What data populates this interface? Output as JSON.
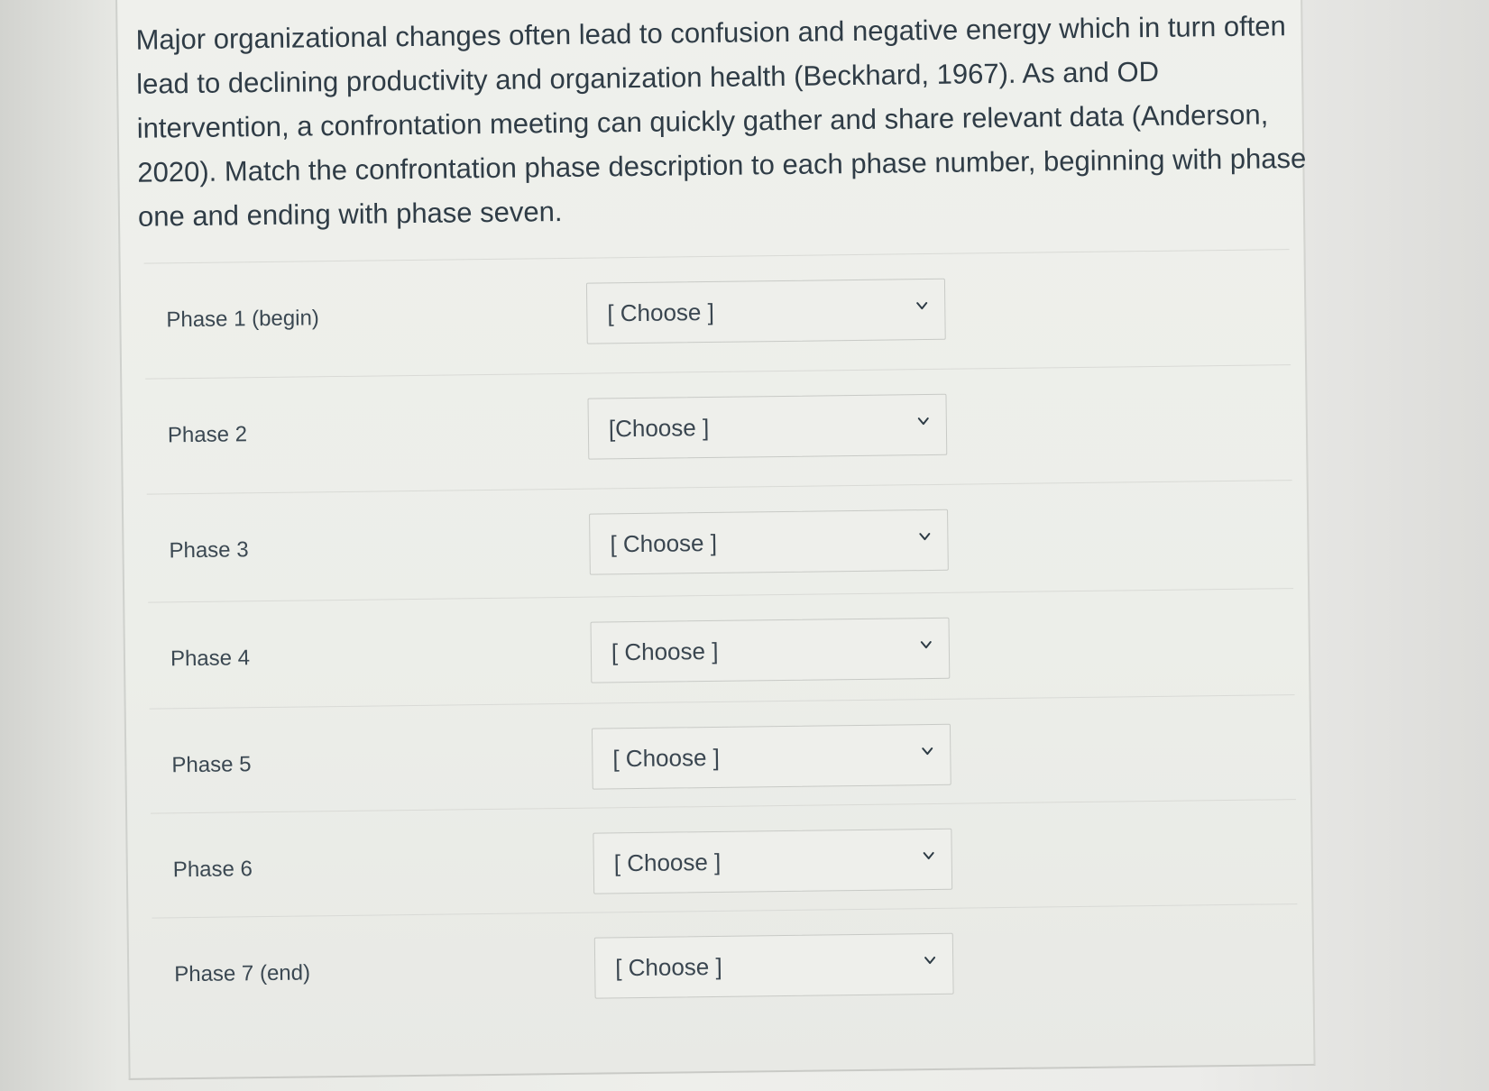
{
  "question": {
    "text": "Major organizational changes often lead to confusion and negative energy which in turn often lead to declining productivity and organization health (Beckhard, 1967). As and OD intervention, a confrontation meeting can quickly gather and share relevant data (Anderson, 2020). Match the confrontation phase description to each phase number, beginning with phase one and ending with phase seven."
  },
  "rows": [
    {
      "label": "Phase 1 (begin)",
      "select_value": "[ Choose ]"
    },
    {
      "label": "Phase 2",
      "select_value": "[Choose ]"
    },
    {
      "label": "Phase 3",
      "select_value": "[ Choose ]"
    },
    {
      "label": "Phase 4",
      "select_value": "[ Choose ]"
    },
    {
      "label": "Phase 5",
      "select_value": "[ Choose ]"
    },
    {
      "label": "Phase 6",
      "select_value": "[ Choose ]"
    },
    {
      "label": "Phase 7 (end)",
      "select_value": "[ Choose ]"
    }
  ],
  "icons": {
    "dropdown": "chevron-down-icon"
  }
}
